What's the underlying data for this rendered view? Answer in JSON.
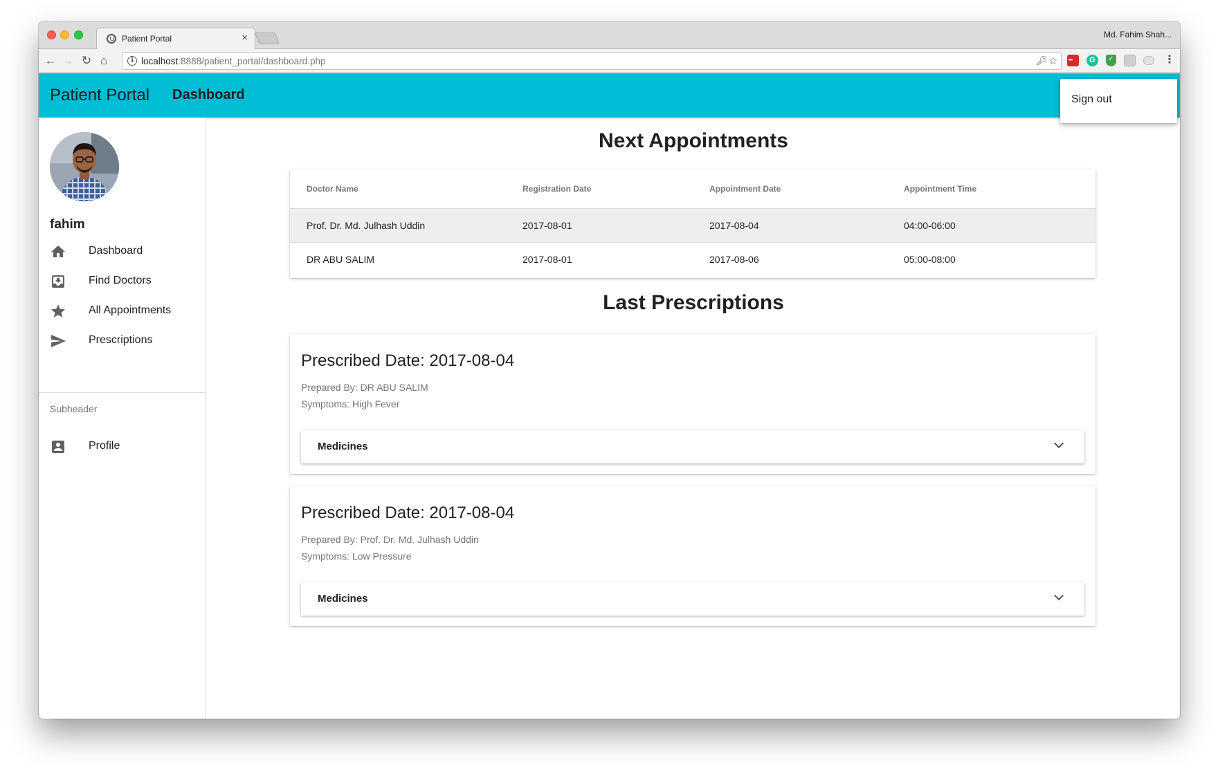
{
  "browser": {
    "tab_title": "Patient Portal",
    "tab_close": "×",
    "profile_name": "Md. Fahim Shah...",
    "url_host": "localhost",
    "url_path": ":8888/patient_portal/dashboard.php",
    "info": "i"
  },
  "app": {
    "title": "Patient Portal",
    "nav_dashboard": "Dashboard",
    "accent_color": "#00bcd4"
  },
  "menu": {
    "sign_out": "Sign out"
  },
  "sidebar": {
    "username": "fahim",
    "items": [
      {
        "label": "Dashboard",
        "icon": "home-icon"
      },
      {
        "label": "Find Doctors",
        "icon": "move-to-inbox-icon"
      },
      {
        "label": "All Appointments",
        "icon": "star-icon"
      },
      {
        "label": "Prescriptions",
        "icon": "send-icon"
      }
    ],
    "subheader": "Subheader",
    "profile": {
      "label": "Profile",
      "icon": "account-box-icon"
    }
  },
  "appointments": {
    "title": "Next Appointments",
    "columns": [
      "Doctor Name",
      "Registration Date",
      "Appointment Date",
      "Appointment Time"
    ],
    "rows": [
      [
        "Prof. Dr. Md. Julhash Uddin",
        "2017-08-01",
        "2017-08-04",
        "04:00-06:00"
      ],
      [
        "DR ABU SALIM",
        "2017-08-01",
        "2017-08-06",
        "05:00-08:00"
      ]
    ]
  },
  "prescriptions": {
    "title": "Last Prescriptions",
    "items": [
      {
        "date": "Prescribed Date: 2017-08-04",
        "prepared_by": "Prepared By: DR ABU SALIM",
        "symptoms": "Symptoms: High Fever",
        "medicines_label": "Medicines"
      },
      {
        "date": "Prescribed Date: 2017-08-04",
        "prepared_by": "Prepared By: Prof. Dr. Md. Julhash Uddin",
        "symptoms": "Symptoms: Low Pressure",
        "medicines_label": "Medicines"
      }
    ]
  }
}
